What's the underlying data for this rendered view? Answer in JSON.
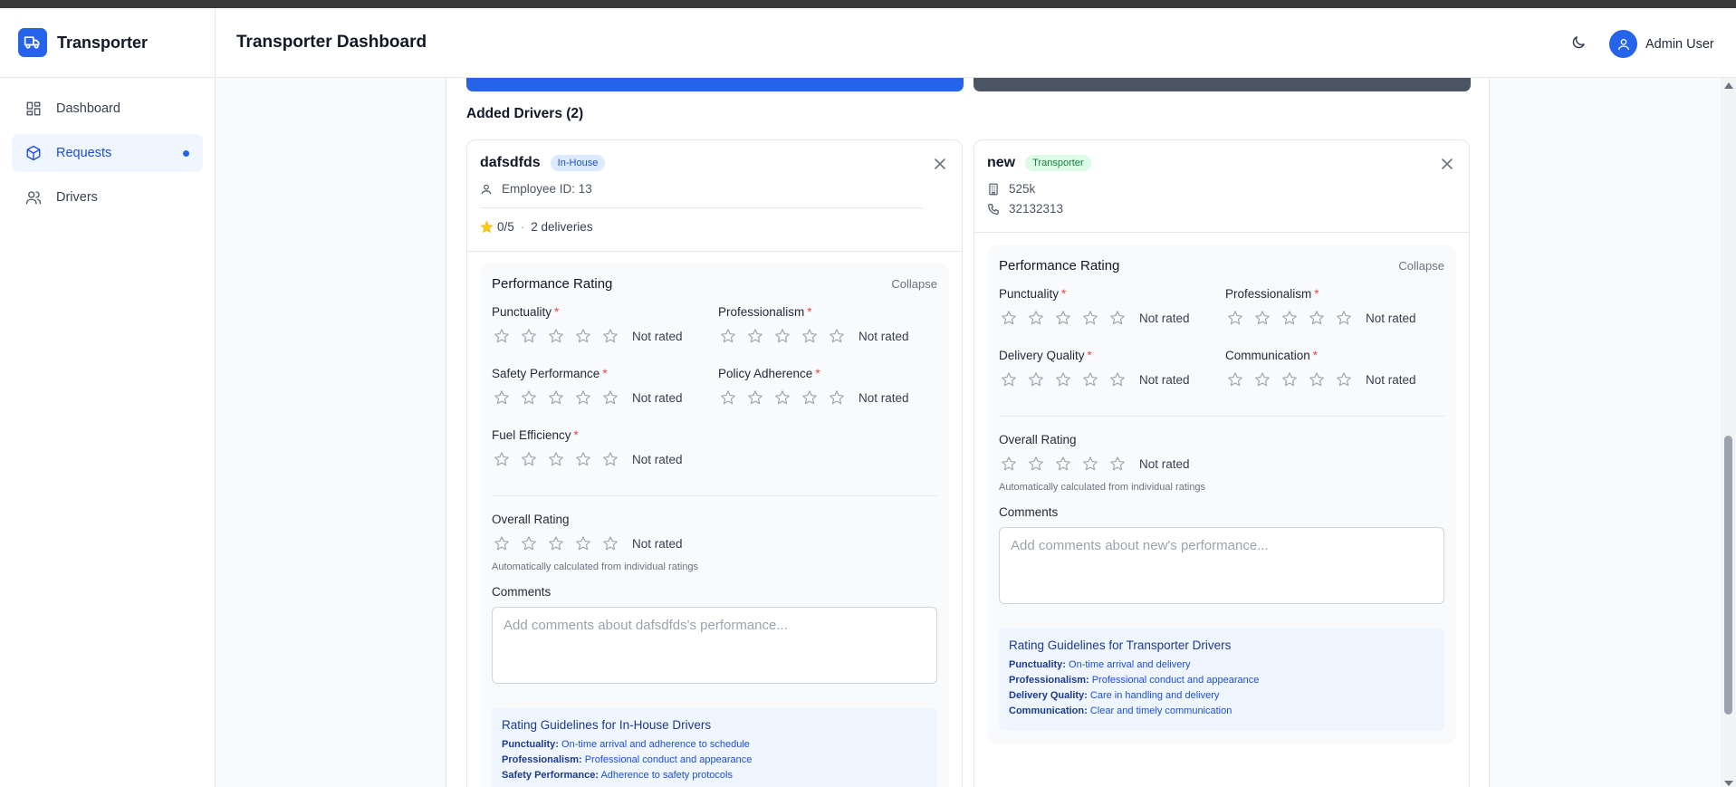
{
  "app": {
    "name": "Transporter",
    "logo_icon": "truck-icon"
  },
  "header": {
    "title": "Transporter Dashboard",
    "user_name": "Admin User",
    "theme_icon": "moon-icon"
  },
  "sidebar": {
    "items": [
      {
        "label": "Dashboard",
        "icon": "dashboard-icon",
        "active": false
      },
      {
        "label": "Requests",
        "icon": "package-icon",
        "active": true
      },
      {
        "label": "Drivers",
        "icon": "users-icon",
        "active": false
      }
    ]
  },
  "section": {
    "title": "Added Drivers (2)"
  },
  "cards": [
    {
      "name": "dafsdfds",
      "badge": "In-House",
      "meta1": "Employee ID: 13",
      "rating": "0/5",
      "deliveries": "2 deliveries",
      "perf_title": "Performance Rating",
      "collapse": "Collapse",
      "criteria": [
        {
          "label": "Punctuality",
          "status": "Not rated",
          "rating": 0
        },
        {
          "label": "Professionalism",
          "status": "Not rated",
          "rating": 0
        },
        {
          "label": "Safety Performance",
          "status": "Not rated",
          "rating": 0
        },
        {
          "label": "Policy Adherence",
          "status": "Not rated",
          "rating": 0
        },
        {
          "label": "Fuel Efficiency",
          "status": "Not rated",
          "rating": 0
        }
      ],
      "overall_label": "Overall Rating",
      "overall_status": "Not rated",
      "note": "Automatically calculated from individual ratings",
      "comments_label": "Comments",
      "comments_placeholder": "Add comments about dafsdfds's performance...",
      "guide_title": "Rating Guidelines for In-House Drivers",
      "guides": [
        {
          "term": "Punctuality:",
          "desc": "On-time arrival and adherence to schedule"
        },
        {
          "term": "Professionalism:",
          "desc": "Professional conduct and appearance"
        },
        {
          "term": "Safety Performance:",
          "desc": "Adherence to safety protocols"
        }
      ]
    },
    {
      "name": "new",
      "badge": "Transporter",
      "meta1": "525k",
      "meta2": "32132313",
      "perf_title": "Performance Rating",
      "collapse": "Collapse",
      "criteria": [
        {
          "label": "Punctuality",
          "status": "Not rated",
          "rating": 0
        },
        {
          "label": "Professionalism",
          "status": "Not rated",
          "rating": 0
        },
        {
          "label": "Delivery Quality",
          "status": "Not rated",
          "rating": 0
        },
        {
          "label": "Communication",
          "status": "Not rated",
          "rating": 0
        }
      ],
      "overall_label": "Overall Rating",
      "overall_status": "Not rated",
      "note": "Automatically calculated from individual ratings",
      "comments_label": "Comments",
      "comments_placeholder": "Add comments about new's performance...",
      "guide_title": "Rating Guidelines for Transporter Drivers",
      "guides": [
        {
          "term": "Punctuality:",
          "desc": "On-time arrival and delivery"
        },
        {
          "term": "Professionalism:",
          "desc": "Professional conduct and appearance"
        },
        {
          "term": "Delivery Quality:",
          "desc": "Care in handling and delivery"
        },
        {
          "term": "Communication:",
          "desc": "Clear and timely communication"
        }
      ]
    }
  ],
  "colors": {
    "accent": "#2563eb",
    "star_outline": "#9ca3af",
    "star_filled": "#facc15",
    "required": "#ef4444"
  }
}
